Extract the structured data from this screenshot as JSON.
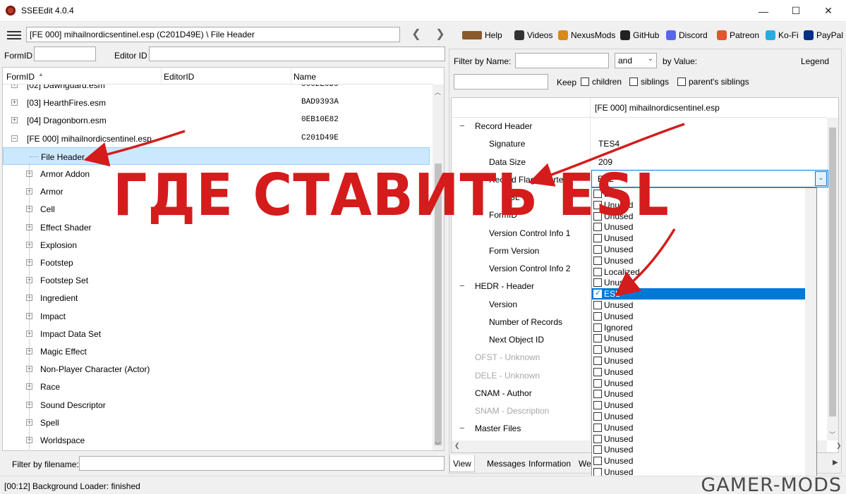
{
  "window": {
    "title": "SSEEdit 4.0.4",
    "controls": [
      "—",
      "☐",
      "✕"
    ]
  },
  "path_field": "[FE 000] mihailnordicsentinel.esp (C201D49E) \\ File Header",
  "toolbar_links": [
    {
      "label": "Help",
      "icon": "book-icon",
      "color": "#8b5a2b"
    },
    {
      "label": "Videos",
      "icon": "video-icon",
      "color": "#333333"
    },
    {
      "label": "NexusMods",
      "icon": "nexus-icon",
      "color": "#d98a1a"
    },
    {
      "label": "GitHub",
      "icon": "github-icon",
      "color": "#222222"
    },
    {
      "label": "Discord",
      "icon": "discord-icon",
      "color": "#5865f2"
    },
    {
      "label": "Patreon",
      "icon": "patreon-icon",
      "color": "#e2552d"
    },
    {
      "label": "Ko-Fi",
      "icon": "kofi-icon",
      "color": "#29abe0"
    },
    {
      "label": "PayPal",
      "icon": "paypal-icon",
      "color": "#003087"
    }
  ],
  "left": {
    "formid_label": "FormID",
    "editorid_label": "Editor ID",
    "columns": [
      "FormID",
      "EditorID",
      "Name"
    ],
    "sort_indicator": "▲",
    "tree": [
      {
        "label": "[02] Dawnguard.esm",
        "name": "0002E0D9",
        "level": 0,
        "expandable": true
      },
      {
        "label": "[03] HearthFires.esm",
        "name": "BAD9393A",
        "level": 0,
        "expandable": true
      },
      {
        "label": "[04] Dragonborn.esm",
        "name": "0EB10E82",
        "level": 0,
        "expandable": true
      },
      {
        "label": "[FE 000] mihailnordicsentinel.esp",
        "name": "C201D49E",
        "level": 0,
        "expandable": true,
        "expanded": true
      },
      {
        "label": "File Header",
        "name": "",
        "level": 1,
        "expandable": false,
        "selected": true
      },
      {
        "label": "Armor Addon",
        "name": "",
        "level": 1,
        "expandable": true
      },
      {
        "label": "Armor",
        "name": "",
        "level": 1,
        "expandable": true
      },
      {
        "label": "Cell",
        "name": "",
        "level": 1,
        "expandable": true
      },
      {
        "label": "Effect Shader",
        "name": "",
        "level": 1,
        "expandable": true
      },
      {
        "label": "Explosion",
        "name": "",
        "level": 1,
        "expandable": true
      },
      {
        "label": "Footstep",
        "name": "",
        "level": 1,
        "expandable": true
      },
      {
        "label": "Footstep Set",
        "name": "",
        "level": 1,
        "expandable": true
      },
      {
        "label": "Ingredient",
        "name": "",
        "level": 1,
        "expandable": true
      },
      {
        "label": "Impact",
        "name": "",
        "level": 1,
        "expandable": true
      },
      {
        "label": "Impact Data Set",
        "name": "",
        "level": 1,
        "expandable": true
      },
      {
        "label": "Magic Effect",
        "name": "",
        "level": 1,
        "expandable": true
      },
      {
        "label": "Non-Player Character (Actor)",
        "name": "",
        "level": 1,
        "expandable": true
      },
      {
        "label": "Race",
        "name": "",
        "level": 1,
        "expandable": true
      },
      {
        "label": "Sound Descriptor",
        "name": "",
        "level": 1,
        "expandable": true
      },
      {
        "label": "Spell",
        "name": "",
        "level": 1,
        "expandable": true
      },
      {
        "label": "Worldspace",
        "name": "",
        "level": 1,
        "expandable": true
      }
    ],
    "filter_label": "Filter by filename:"
  },
  "right": {
    "filter_name_label": "Filter by Name:",
    "operator": "and",
    "value_label": "by Value:",
    "legend": "Legend",
    "keep_label": "Keep",
    "checks": [
      "children",
      "siblings",
      "parent's siblings"
    ],
    "column_header": "[FE 000] mihailnordicsentinel.esp",
    "records": [
      {
        "label": "Record Header",
        "value": "",
        "level": 0,
        "tog": "−"
      },
      {
        "label": "Signature",
        "value": "TES4",
        "level": 1
      },
      {
        "label": "Data Size",
        "value": "209",
        "level": 1
      },
      {
        "label": "Record Flags (sorted)",
        "value": "ESL",
        "level": 1,
        "tog": "−"
      },
      {
        "label": "ESL",
        "value": "",
        "level": 2
      },
      {
        "label": "FormID",
        "value": "",
        "level": 1
      },
      {
        "label": "Version Control Info 1",
        "value": "",
        "level": 1
      },
      {
        "label": "Form Version",
        "value": "",
        "level": 1
      },
      {
        "label": "Version Control Info 2",
        "value": "",
        "level": 1
      },
      {
        "label": "HEDR - Header",
        "value": "",
        "level": 0,
        "tog": "−"
      },
      {
        "label": "Version",
        "value": "",
        "level": 1
      },
      {
        "label": "Number of Records",
        "value": "",
        "level": 1
      },
      {
        "label": "Next Object ID",
        "value": "",
        "level": 1
      },
      {
        "label": "OFST - Unknown",
        "value": "",
        "level": 0,
        "dim": true
      },
      {
        "label": "DELE - Unknown",
        "value": "",
        "level": 0,
        "dim": true
      },
      {
        "label": "CNAM - Author",
        "value": "",
        "level": 0
      },
      {
        "label": "SNAM - Description",
        "value": "",
        "level": 0,
        "dim": true
      },
      {
        "label": "Master Files",
        "value": "",
        "level": 0,
        "tog": "−"
      }
    ],
    "flags_selected": "ESL",
    "flag_options": [
      {
        "label": "ESM",
        "checked": false
      },
      {
        "label": "Unused",
        "checked": false
      },
      {
        "label": "Unused",
        "checked": false
      },
      {
        "label": "Unused",
        "checked": false
      },
      {
        "label": "Unused",
        "checked": false
      },
      {
        "label": "Unused",
        "checked": false
      },
      {
        "label": "Unused",
        "checked": false
      },
      {
        "label": "Localized",
        "checked": false
      },
      {
        "label": "Unused",
        "checked": false
      },
      {
        "label": "ESL",
        "checked": true,
        "highlighted": true
      },
      {
        "label": "Unused",
        "checked": false
      },
      {
        "label": "Unused",
        "checked": false
      },
      {
        "label": "Ignored",
        "checked": false
      },
      {
        "label": "Unused",
        "checked": false
      },
      {
        "label": "Unused",
        "checked": false
      },
      {
        "label": "Unused",
        "checked": false
      },
      {
        "label": "Unused",
        "checked": false
      },
      {
        "label": "Unused",
        "checked": false
      },
      {
        "label": "Unused",
        "checked": false
      },
      {
        "label": "Unused",
        "checked": false
      },
      {
        "label": "Unused",
        "checked": false
      },
      {
        "label": "Unused",
        "checked": false
      },
      {
        "label": "Unused",
        "checked": false
      },
      {
        "label": "Unused",
        "checked": false
      },
      {
        "label": "Unused",
        "checked": false
      },
      {
        "label": "Unused",
        "checked": false
      },
      {
        "label": "Unused",
        "checked": false
      },
      {
        "label": "Unused",
        "checked": false
      }
    ],
    "tabs": [
      "View",
      "Messages",
      "Information",
      "We"
    ]
  },
  "status": "[00:12] Background Loader: finished",
  "overlay_text": "ГДЕ СТАВИТЬ ESL",
  "watermark": "GAMER-MODS",
  "accent_color": "#d41c1c"
}
